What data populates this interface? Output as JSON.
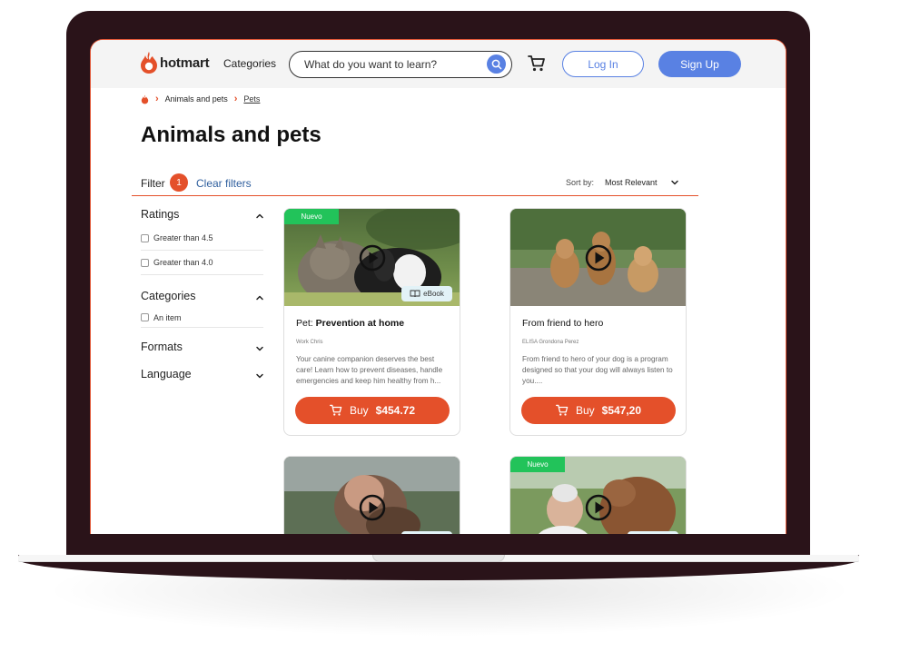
{
  "header": {
    "logo_text": "hotmart",
    "categories_label": "Categories",
    "search_placeholder": "What do you want to learn?",
    "login_label": "Log In",
    "signup_label": "Sign Up"
  },
  "breadcrumb": {
    "category": "Animals and pets",
    "current": "Pets"
  },
  "page_title": "Animals and pets",
  "filter_bar": {
    "filter_label": "Filter",
    "filter_count": "1",
    "clear_filters": "Clear filters",
    "sort_label": "Sort by:",
    "sort_value": "Most Relevant"
  },
  "sidebar": {
    "ratings_title": "Ratings",
    "ratings_options": [
      "Greater than 4.5",
      "Greater than 4.0"
    ],
    "categories_title": "Categories",
    "categories_options": [
      "An item"
    ],
    "formats_title": "Formats",
    "language_title": "Language"
  },
  "products": [
    {
      "badge": "Nuevo",
      "format": "eBook",
      "title_prefix": "Pet: ",
      "title_main": "Prevention at home",
      "author": "Work Chris",
      "description": "Your canine companion deserves the best care! Learn how to prevent diseases, handle emergencies and keep him healthy from h...",
      "buy_label": "Buy",
      "price": "$454.72"
    },
    {
      "title_main": "From friend to hero",
      "author": "ELISA Grondona Perez",
      "description": "From friend to hero of your dog is a program designed so that your dog will always listen to you....",
      "buy_label": "Buy",
      "price": "$547,20"
    },
    {},
    {
      "badge": "Nuevo"
    }
  ],
  "colors": {
    "brand_orange": "#e4502a",
    "accent_blue": "#5981e3",
    "badge_green": "#22c35a",
    "frame_dark": "#2a1319"
  }
}
